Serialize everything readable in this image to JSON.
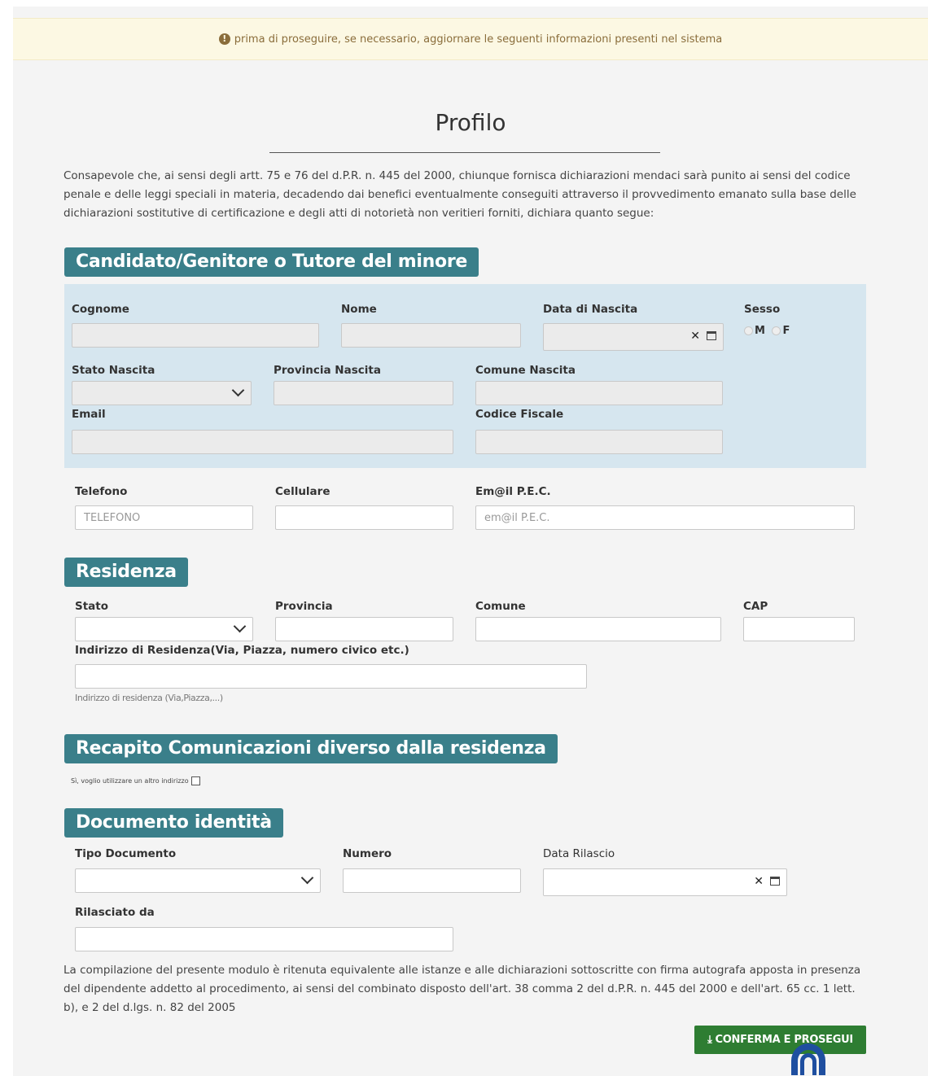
{
  "alert": {
    "text": "prima di proseguire, se necessario, aggiornare le seguenti informazioni presenti nel sistema"
  },
  "page": {
    "title": "Profilo",
    "intro": "Consapevole che, ai sensi degli artt. 75 e 76 del d.P.R. n. 445 del 2000, chiunque fornisca dichiarazioni mendaci sarà punito ai sensi del codice penale e delle leggi speciali in materia, decadendo dai benefici eventualmente conseguiti attraverso il provvedimento emanato sulla base delle dichiarazioni sostitutive di certificazione e degli atti di notorietà non veritieri forniti, dichiara quanto segue:",
    "footer": "La compilazione del presente modulo è ritenuta equivalente alle istanze e alle dichiarazioni sottoscritte con firma autografa apposta in presenza del dipendente addetto al procedimento, ai sensi del combinato disposto dell'art. 38 comma 2 del d.P.R. n. 445 del 2000 e dell'art. 65 cc. 1 lett. b), e 2 del d.lgs. n. 82 del 2005"
  },
  "candidato": {
    "heading": "Candidato/Genitore o Tutore del minore",
    "cognome": "Cognome",
    "nome": "Nome",
    "data_nascita": "Data di Nascita",
    "sesso": "Sesso",
    "sesso_m": "M",
    "sesso_f": "F",
    "stato_nascita": "Stato Nascita",
    "provincia_nascita": "Provincia Nascita",
    "comune_nascita": "Comune Nascita",
    "email": "Email",
    "codice_fiscale": "Codice Fiscale",
    "telefono": "Telefono",
    "telefono_placeholder": "TELEFONO",
    "cellulare": "Cellulare",
    "pec": "Em@il P.E.C.",
    "pec_placeholder": "em@il P.E.C."
  },
  "residenza": {
    "heading": "Residenza",
    "stato": "Stato",
    "provincia": "Provincia",
    "comune": "Comune",
    "cap": "CAP",
    "indirizzo": "Indirizzo di Residenza(Via, Piazza, numero civico etc.)",
    "indirizzo_hint": "Indirizzo di residenza (Via,Piazza,...)"
  },
  "recapito": {
    "heading": "Recapito Comunicazioni diverso dalla residenza",
    "checkbox_label": "Sì, voglio utilizzare un altro indirizzo"
  },
  "documento": {
    "heading": "Documento identità",
    "tipo": "Tipo Documento",
    "numero": "Numero",
    "data_rilascio": "Data Rilascio",
    "rilasciato_da": "Rilasciato da"
  },
  "actions": {
    "confirm": "CONFERMA E PROSEGUI"
  },
  "icons": {
    "alert": "exclamation-circle-icon",
    "confirm": "download-icon",
    "clear": "close-icon",
    "calendar": "calendar-icon",
    "select": "chevron-down-icon"
  },
  "colors": {
    "section_bg": "#3a7f8a",
    "panel_bg": "#d6e6ef",
    "alert_bg": "#fcf8e3",
    "confirm_bg": "#2e7d32"
  }
}
